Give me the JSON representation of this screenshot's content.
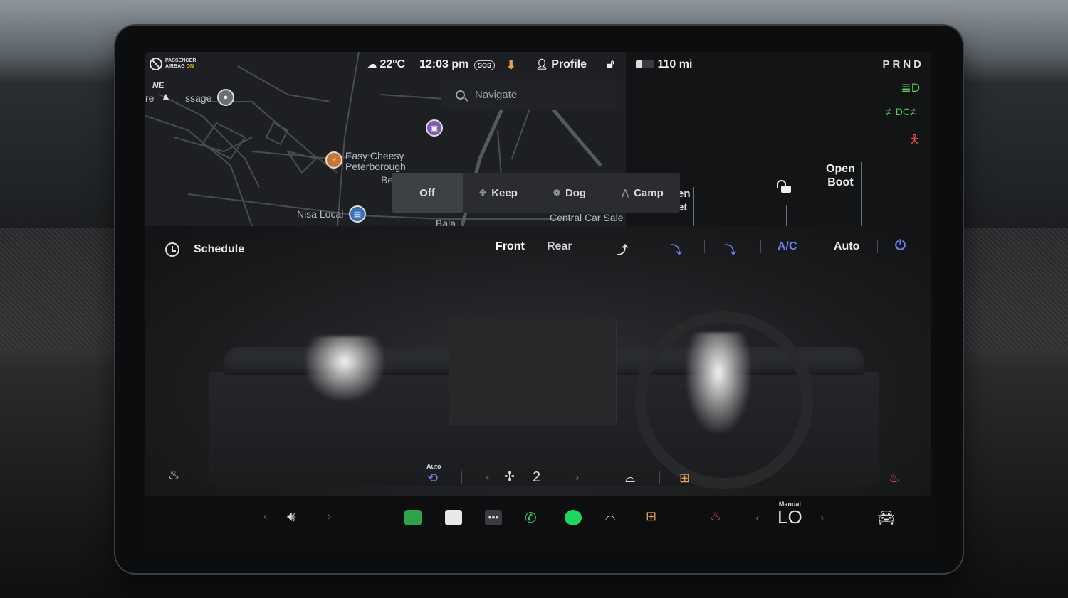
{
  "status_bar": {
    "airbag_line1": "PASSENGER",
    "airbag_line2": "AIRBAG",
    "airbag_state": "ON",
    "temperature": "22°C",
    "time": "12:03 pm",
    "sos": "SOS",
    "profile": "Profile",
    "range": "110 mi",
    "gear": "PRND"
  },
  "map": {
    "compass": "NE",
    "search_placeholder": "Navigate",
    "labels": {
      "massage": "ssage",
      "left_fragment": "re",
      "easy_cheesy": "Easy Cheesy\nPeterborough",
      "be_fragment": "Be",
      "nisa_local": "Nisa Local",
      "central_car_sale": "Central Car Sale",
      "bottom_fragment": "Bala",
      "en_fragment": "en\net"
    }
  },
  "modes": {
    "items": [
      {
        "label": "Off",
        "icon": ""
      },
      {
        "label": "Keep",
        "icon": "fan-icon"
      },
      {
        "label": "Dog",
        "icon": "paw-icon"
      },
      {
        "label": "Camp",
        "icon": "tent-icon"
      }
    ]
  },
  "right_panel": {
    "open_boot": "Open\nBoot"
  },
  "climate": {
    "schedule": "Schedule",
    "front": "Front",
    "rear": "Rear",
    "ac": "A/C",
    "auto": "Auto",
    "recirc_label": "Auto",
    "fan_speed": "2",
    "colors": {
      "accent_blue": "#6d7cf2",
      "heat_orange": "#e8a155",
      "heat_red": "#e54848"
    }
  },
  "dock": {
    "temp_mode": "Manual",
    "temp_value": "LO"
  }
}
